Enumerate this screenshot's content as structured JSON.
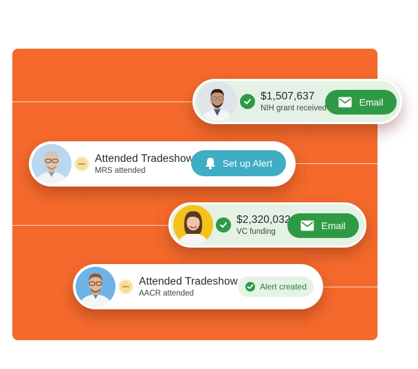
{
  "cards": [
    {
      "amount": "$1,507,637",
      "subtitle": "NIH grant received",
      "button": "Email",
      "status": "check"
    },
    {
      "title": "Attended Tradeshow",
      "subtitle": "MRS attended",
      "button": "Set up Alert",
      "status": "pending"
    },
    {
      "amount": "$2,320,032",
      "subtitle": "VC funding",
      "button": "Email",
      "status": "check"
    },
    {
      "title": "Attended Tradeshow",
      "subtitle": "AACR attended",
      "button": "Alert created",
      "status": "pending"
    }
  ],
  "colors": {
    "panel": "#f56a2c",
    "email_button": "#2e9a45",
    "alert_button": "#3fadc4",
    "created_button_bg": "#e5f2e6",
    "card_green": "#e3f2e4"
  },
  "icons": [
    "check-icon",
    "minus-icon",
    "envelope-icon",
    "bell-icon"
  ]
}
